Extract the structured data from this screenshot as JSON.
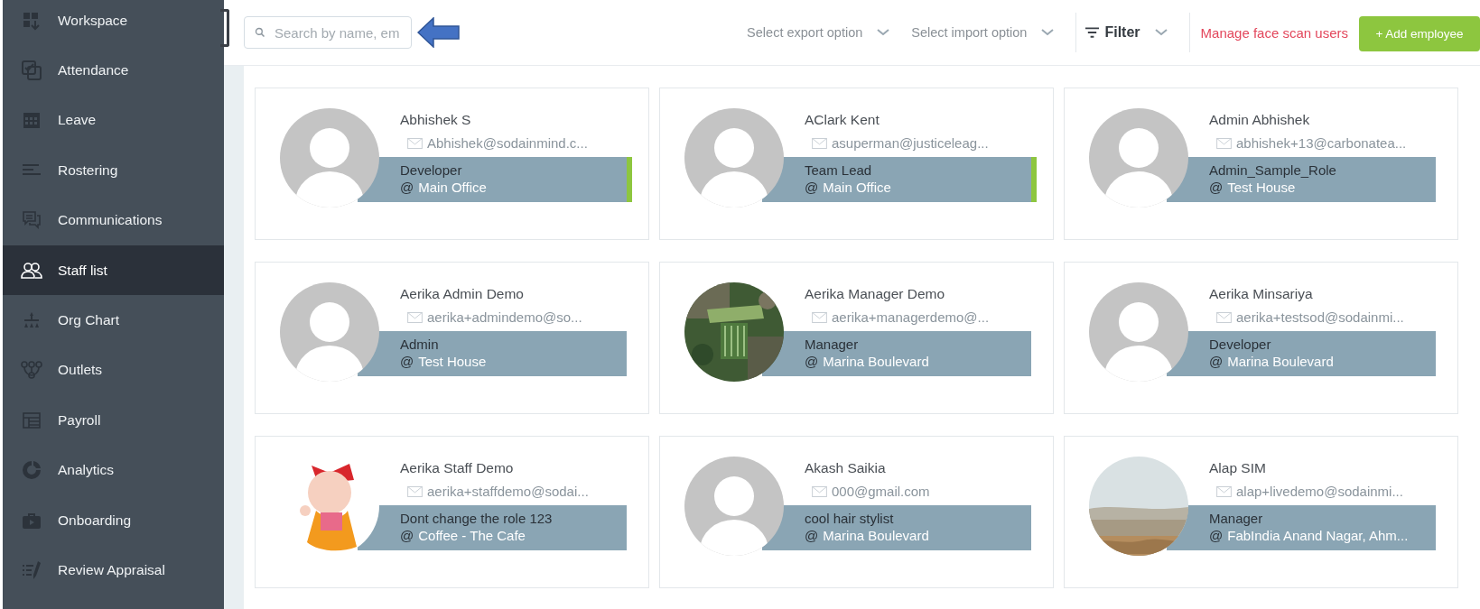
{
  "sidebar": {
    "items": [
      {
        "label": "Workspace",
        "selected": false
      },
      {
        "label": "Attendance",
        "selected": false
      },
      {
        "label": "Leave",
        "selected": false
      },
      {
        "label": "Rostering",
        "selected": false
      },
      {
        "label": "Communications",
        "selected": false
      },
      {
        "label": "Staff list",
        "selected": true
      },
      {
        "label": "Org Chart",
        "selected": false
      },
      {
        "label": "Outlets",
        "selected": false
      },
      {
        "label": "Payroll",
        "selected": false
      },
      {
        "label": "Analytics",
        "selected": false
      },
      {
        "label": "Onboarding",
        "selected": false
      },
      {
        "label": "Review Appraisal",
        "selected": false
      }
    ]
  },
  "toolbar": {
    "search": {
      "placeholder": "Search by name, em"
    },
    "export": "Select export option",
    "import": "Select import option",
    "filter": "Filter",
    "link": "Manage face scan users",
    "add_button": "+ Add employee"
  },
  "employees": [
    {
      "name": "Abhishek S",
      "email": "Abhishek@sodainmind.c...",
      "role": "Developer",
      "at": "@",
      "location": "Main Office",
      "kind": "placeholder",
      "marked": true
    },
    {
      "name": "AClark Kent",
      "email": "asuperman@justiceleag...",
      "role": "Team Lead",
      "at": "@",
      "location": "Main Office",
      "kind": "placeholder",
      "marked": true
    },
    {
      "name": "Admin Abhishek",
      "email": "abhishek+13@carbonatea...",
      "role": "Admin_Sample_Role",
      "at": "@",
      "location": "Test House",
      "kind": "placeholder",
      "marked": false
    },
    {
      "name": "Aerika Admin Demo",
      "email": "aerika+admindemo@so...",
      "role": "Admin",
      "at": "@",
      "location": "Test House",
      "kind": "placeholder",
      "marked": false
    },
    {
      "name": "Aerika Manager Demo",
      "email": "aerika+managerdemo@...",
      "role": "Manager",
      "at": "@",
      "location": "Marina Boulevard",
      "kind": "picture",
      "marked": false
    },
    {
      "name": "Aerika Minsariya",
      "email": "aerika+testsod@sodainmi...",
      "role": "Developer",
      "at": "@",
      "location": "Marina Boulevard",
      "kind": "placeholder",
      "marked": false
    },
    {
      "name": "Aerika Staff Demo",
      "email": "aerika+staffdemo@sodai...",
      "role": "Dont change the role 123",
      "at": "@",
      "location": "Coffee - The Cafe",
      "kind": "picture",
      "marked": false
    },
    {
      "name": "Akash Saikia",
      "email": "000@gmail.com",
      "role": "cool hair stylist",
      "at": "@",
      "location": "Marina Boulevard",
      "kind": "placeholder",
      "marked": false
    },
    {
      "name": "Alap SIM",
      "email": "alap+livedemo@sodainmi...",
      "role": "Manager",
      "at": "@",
      "location": "FabIndia Anand Nagar, Ahm...",
      "kind": "picture",
      "marked": false
    }
  ]
}
